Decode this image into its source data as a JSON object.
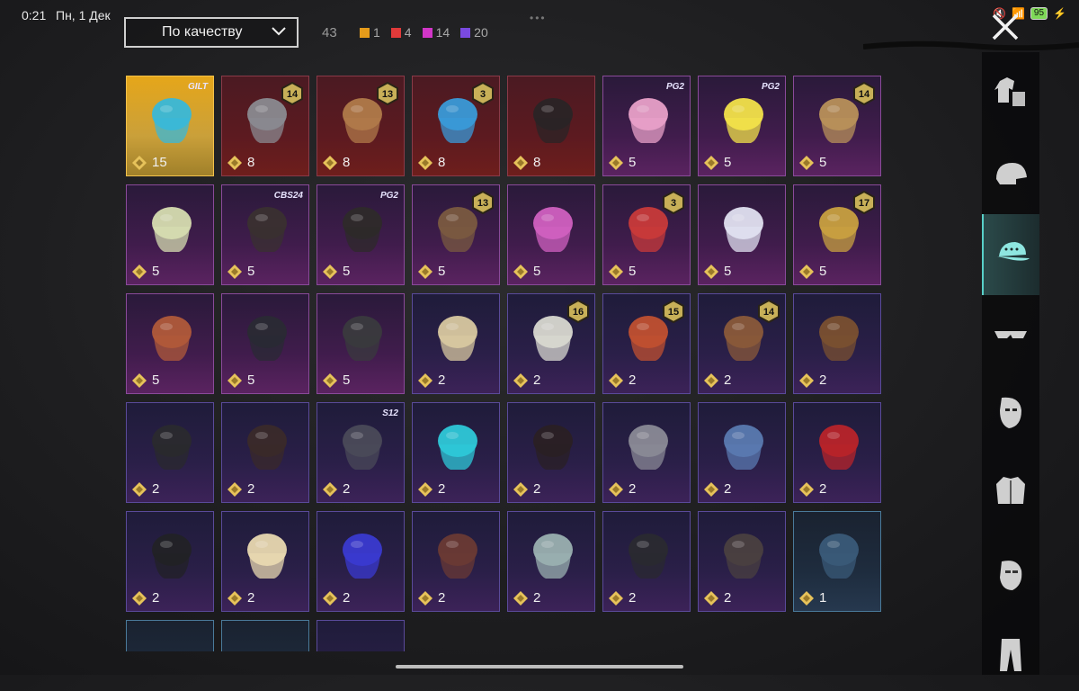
{
  "status_bar": {
    "time": "0:21",
    "date": "Пн, 1 Дек",
    "battery": "95"
  },
  "sort": {
    "label": "По качеству"
  },
  "totals": {
    "count": "43"
  },
  "legend": [
    {
      "color": "#e59b1a",
      "value": "1"
    },
    {
      "color": "#e03a3a",
      "value": "4"
    },
    {
      "color": "#d236c8",
      "value": "14"
    },
    {
      "color": "#7a4ae0",
      "value": "20"
    }
  ],
  "items": [
    {
      "quality": "gold",
      "count": "15",
      "tag": "GILT",
      "art": "hair-blue-icon"
    },
    {
      "quality": "red",
      "count": "8",
      "level": "14",
      "art": "cat-mask-icon"
    },
    {
      "quality": "red",
      "count": "8",
      "level": "13",
      "art": "flower-hat-icon"
    },
    {
      "quality": "red",
      "count": "8",
      "level": "3",
      "art": "clown-mask-icon"
    },
    {
      "quality": "red",
      "count": "8",
      "art": "tricorn-hat-icon"
    },
    {
      "quality": "purple",
      "count": "5",
      "tag": "PG2",
      "art": "bow-headband-icon"
    },
    {
      "quality": "purple",
      "count": "5",
      "tag": "PG2",
      "art": "box-head-icon"
    },
    {
      "quality": "purple",
      "count": "5",
      "level": "14",
      "art": "hair-flower-icon"
    },
    {
      "quality": "purple",
      "count": "5",
      "art": "hair-blonde-icon"
    },
    {
      "quality": "purple",
      "count": "5",
      "tag": "CBS24",
      "art": "hair-dark-icon"
    },
    {
      "quality": "purple",
      "count": "5",
      "tag": "PG2",
      "art": "hair-ribbon-icon"
    },
    {
      "quality": "purple",
      "count": "5",
      "level": "13",
      "art": "goggles-hat-icon"
    },
    {
      "quality": "purple",
      "count": "5",
      "art": "pink-pigtails-icon"
    },
    {
      "quality": "purple",
      "count": "5",
      "level": "3",
      "art": "jester-mask-icon"
    },
    {
      "quality": "purple",
      "count": "5",
      "art": "bunny-mask-icon"
    },
    {
      "quality": "purple",
      "count": "5",
      "level": "17",
      "art": "antler-mask-icon"
    },
    {
      "quality": "purple",
      "count": "5",
      "art": "headband-hair-icon"
    },
    {
      "quality": "purple",
      "count": "5",
      "art": "spiked-helmet-icon"
    },
    {
      "quality": "purple",
      "count": "5",
      "art": "ghost-mask-icon"
    },
    {
      "quality": "violet",
      "count": "2",
      "art": "goggles-hair-icon"
    },
    {
      "quality": "violet",
      "count": "2",
      "level": "16",
      "art": "camo-helmet-icon"
    },
    {
      "quality": "violet",
      "count": "2",
      "level": "15",
      "art": "pumpkin-hat-icon"
    },
    {
      "quality": "violet",
      "count": "2",
      "level": "14",
      "art": "cat-ear-hair-icon"
    },
    {
      "quality": "violet",
      "count": "2",
      "art": "hair-brown-icon"
    },
    {
      "quality": "violet",
      "count": "2",
      "art": "black-cap-icon"
    },
    {
      "quality": "violet",
      "count": "2",
      "art": "cyber-mask-icon"
    },
    {
      "quality": "violet",
      "count": "2",
      "tag": "S12",
      "art": "space-helmet-icon"
    },
    {
      "quality": "violet",
      "count": "2",
      "art": "cyan-hair-icon"
    },
    {
      "quality": "violet",
      "count": "2",
      "art": "top-hat-icon"
    },
    {
      "quality": "violet",
      "count": "2",
      "art": "luchador-mask-icon"
    },
    {
      "quality": "violet",
      "count": "2",
      "art": "shark-hat-icon"
    },
    {
      "quality": "violet",
      "count": "2",
      "art": "red-beret-icon"
    },
    {
      "quality": "violet",
      "count": "2",
      "art": "fedora-icon"
    },
    {
      "quality": "violet",
      "count": "2",
      "art": "cupcake-hat-icon"
    },
    {
      "quality": "violet",
      "count": "2",
      "art": "blue-cap-icon"
    },
    {
      "quality": "violet",
      "count": "2",
      "art": "brown-fedora-icon"
    },
    {
      "quality": "violet",
      "count": "2",
      "art": "plaid-hood-icon"
    },
    {
      "quality": "violet",
      "count": "2",
      "art": "bucket-hat-icon"
    },
    {
      "quality": "violet",
      "count": "2",
      "art": "aviator-cap-icon"
    },
    {
      "quality": "blue",
      "count": "1",
      "art": "blue-beret-icon"
    },
    {
      "quality": "blue",
      "count": "",
      "art": "blank-icon"
    },
    {
      "quality": "blue",
      "count": "",
      "art": "blank-icon"
    },
    {
      "quality": "violet",
      "count": "",
      "art": "blank-icon"
    }
  ],
  "sidebar": [
    {
      "name": "outfit-icon",
      "active": false
    },
    {
      "name": "helmet-icon",
      "active": false
    },
    {
      "name": "cap-icon",
      "active": true
    },
    {
      "name": "glasses-icon",
      "active": false
    },
    {
      "name": "face-mask-icon",
      "active": false
    },
    {
      "name": "jacket-icon",
      "active": false
    },
    {
      "name": "face-icon",
      "active": false
    },
    {
      "name": "pants-icon",
      "active": false
    }
  ]
}
